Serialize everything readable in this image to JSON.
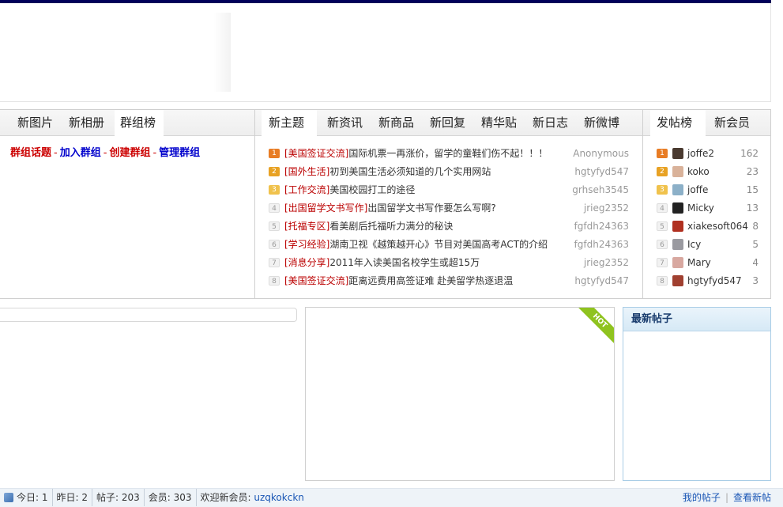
{
  "left_panel": {
    "tabs": [
      "新图片",
      "新相册",
      "群组榜"
    ],
    "links": {
      "topic": "群组话题",
      "join": "加入群组",
      "create": "创建群组",
      "manage": "管理群组",
      "sep": "-"
    }
  },
  "mid_panel": {
    "tabs": [
      "新主题",
      "新资讯",
      "新商品",
      "新回复",
      "精华贴",
      "新日志",
      "新微博"
    ],
    "threads": [
      {
        "num": "1",
        "cat": "[美国签证交流]",
        "title": "国际机票一再涨价，留学的童鞋们伤不起！！！",
        "author": "Anonymous"
      },
      {
        "num": "2",
        "cat": "[国外生活]",
        "title": "初到美国生活必须知道的几个实用网站",
        "author": "hgtyfyd547"
      },
      {
        "num": "3",
        "cat": "[工作交流]",
        "title": "美国校园打工的途径",
        "author": "grhseh3545"
      },
      {
        "num": "4",
        "cat": "[出国留学文书写作]",
        "title": "出国留学文书写作要怎么写啊?",
        "author": "jrieg2352"
      },
      {
        "num": "5",
        "cat": "[托福专区]",
        "title": "看美剧后托福听力满分的秘诀",
        "author": "fgfdh24363"
      },
      {
        "num": "6",
        "cat": "[学习经验]",
        "title": "湖南卫视《越策越开心》节目对美国高考ACT的介绍",
        "author": "fgfdh24363"
      },
      {
        "num": "7",
        "cat": "[消息分享]",
        "title": "2011年入读美国名校学生或超15万",
        "author": "jrieg2352"
      },
      {
        "num": "8",
        "cat": "[美国签证交流]",
        "title": "距离远费用高签证难 赴美留学热逐退温",
        "author": "hgtyfyd547"
      }
    ]
  },
  "right_panel": {
    "tabs": [
      "发帖榜",
      "新会员"
    ],
    "users": [
      {
        "num": "1",
        "name": "joffe2",
        "count": "162",
        "color": "#4a3a30"
      },
      {
        "num": "2",
        "name": "koko",
        "count": "23",
        "color": "#d9b29a"
      },
      {
        "num": "3",
        "name": "joffe",
        "count": "15",
        "color": "#8cb0c8"
      },
      {
        "num": "4",
        "name": "Micky",
        "count": "13",
        "color": "#222222"
      },
      {
        "num": "5",
        "name": "xiakesoft064",
        "count": "8",
        "color": "#b03020"
      },
      {
        "num": "6",
        "name": "Icy",
        "count": "5",
        "color": "#9a9aa0"
      },
      {
        "num": "7",
        "name": "Mary",
        "count": "4",
        "color": "#d8a8a0"
      },
      {
        "num": "8",
        "name": "hgtyfyd547",
        "count": "3",
        "color": "#a04030"
      }
    ]
  },
  "hot_box": {
    "ribbon": "HOT"
  },
  "new_posts_box": {
    "title": "最新帖子"
  },
  "footer": {
    "today": "今日: 1",
    "yesterday": "昨日: 2",
    "posts": "帖子: 203",
    "members": "会员: 303",
    "welcome": "欢迎新会员: ",
    "new_member": "uzqkokckn",
    "my_posts": "我的帖子",
    "view_new": "查看新帖"
  }
}
